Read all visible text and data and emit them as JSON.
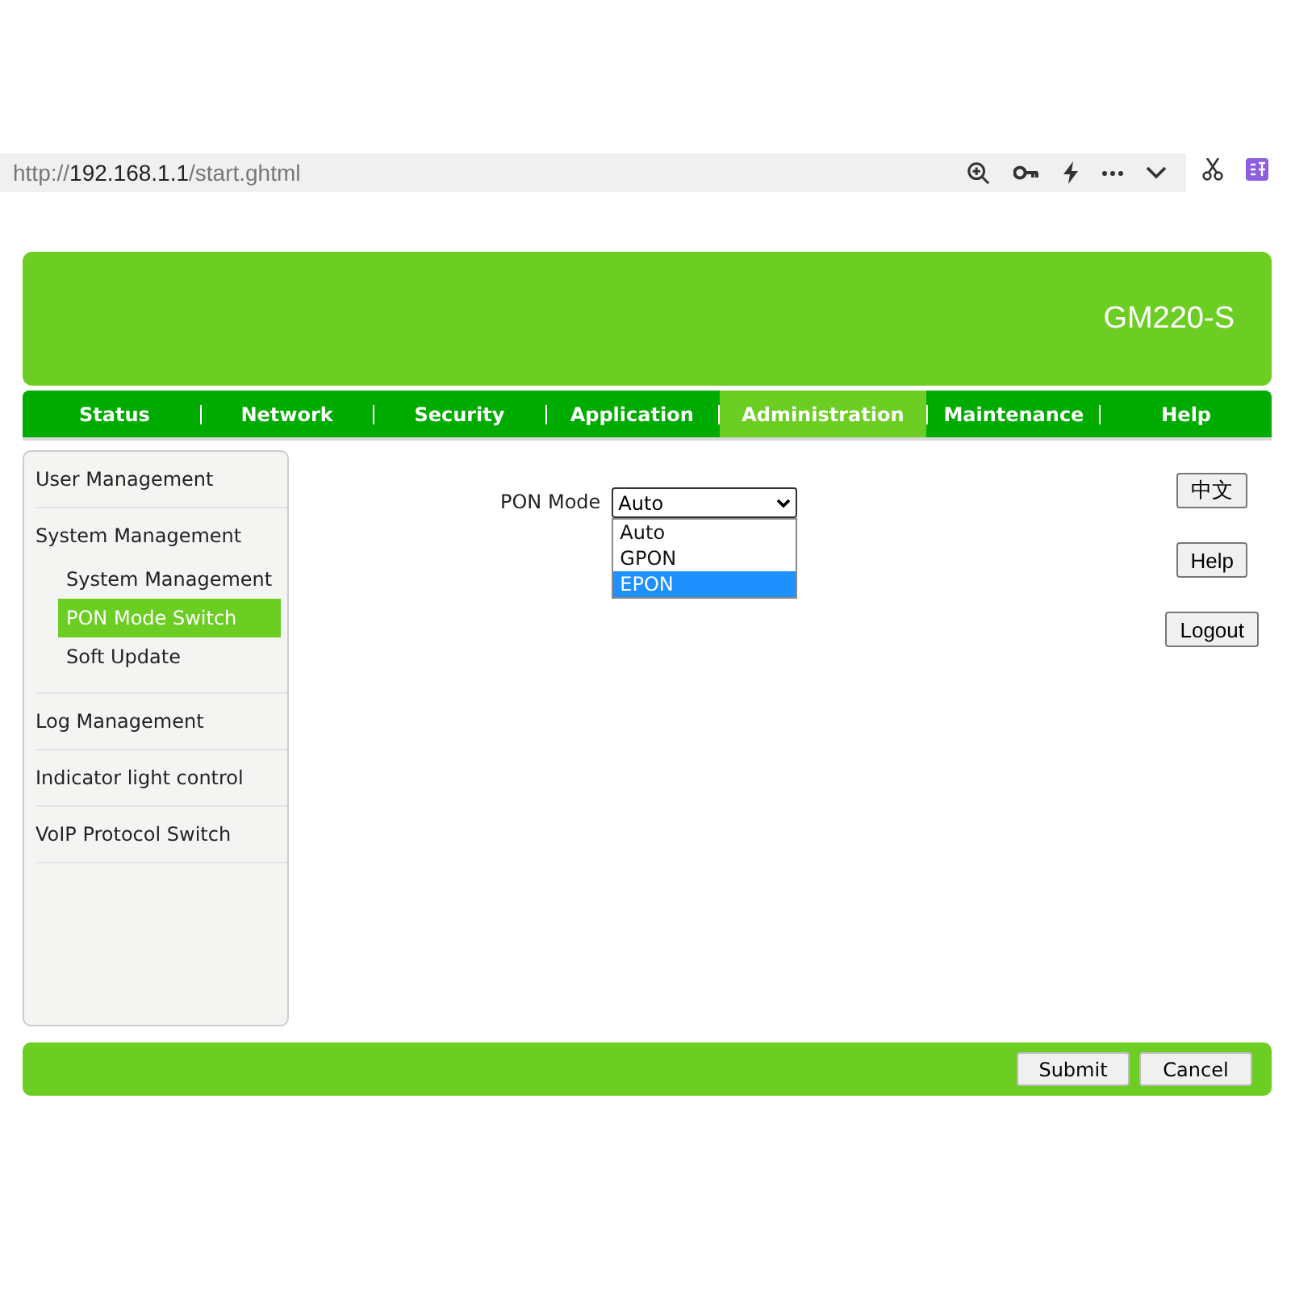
{
  "address_bar": {
    "url": {
      "scheme": "http://",
      "host": "192.168.1.1",
      "path": "/start.ghtml"
    }
  },
  "header": {
    "model": "GM220-S"
  },
  "nav": [
    {
      "label": "Status",
      "selected": false
    },
    {
      "label": "Network",
      "selected": false
    },
    {
      "label": "Security",
      "selected": false
    },
    {
      "label": "Application",
      "selected": false
    },
    {
      "label": "Administration",
      "selected": true
    },
    {
      "label": "Maintenance",
      "selected": false
    },
    {
      "label": "Help",
      "selected": false
    }
  ],
  "sidebar": [
    {
      "label": "User Management",
      "selected": false
    },
    {
      "label": "System Management",
      "selected": false,
      "children": [
        {
          "label": "System Management",
          "selected": false
        },
        {
          "label": "PON Mode Switch",
          "selected": true
        },
        {
          "label": "Soft Update",
          "selected": false
        }
      ]
    },
    {
      "label": "Log Management",
      "selected": false
    },
    {
      "label": "Indicator light control",
      "selected": false
    },
    {
      "label": "VoIP Protocol Switch",
      "selected": false
    }
  ],
  "pon_mode": {
    "label": "PON Mode",
    "value": "Auto",
    "expanded": true,
    "options": [
      {
        "label": "Auto",
        "highlighted": false
      },
      {
        "label": "GPON",
        "highlighted": false
      },
      {
        "label": "EPON",
        "highlighted": true
      }
    ]
  },
  "side_buttons": [
    "中文",
    "Help",
    "Logout"
  ],
  "footer_buttons": [
    "Submit",
    "Cancel"
  ]
}
